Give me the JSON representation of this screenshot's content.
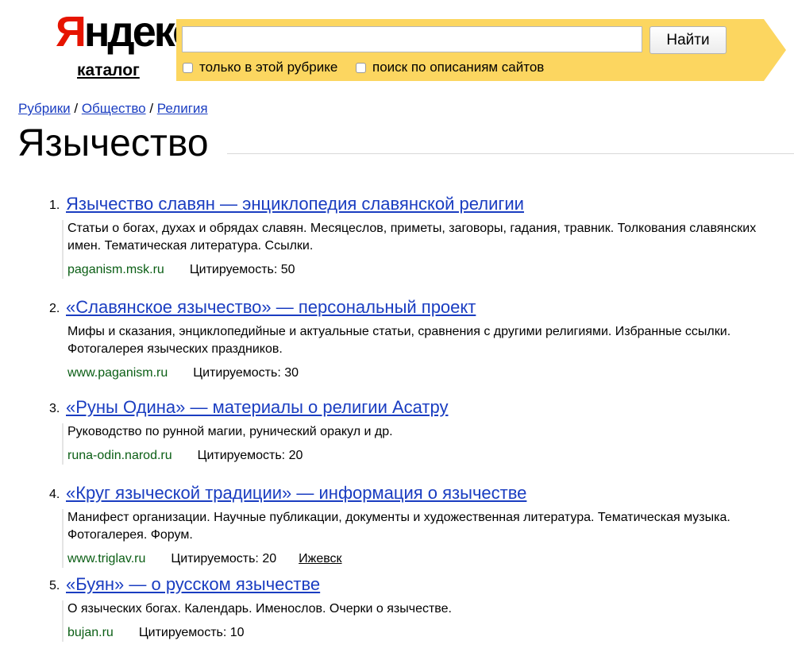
{
  "header": {
    "logo_red": "Я",
    "logo_black": "ндекс",
    "catalog_link": "каталог"
  },
  "search": {
    "query": "",
    "button_label": "Найти",
    "option_rubric": "только в этой рубрике",
    "option_descriptions": "поиск по описаниям сайтов"
  },
  "breadcrumb": {
    "items": [
      "Рубрики",
      "Общество",
      "Религия"
    ],
    "separator": " / "
  },
  "page": {
    "title": "Язычество"
  },
  "results": [
    {
      "number": "1.",
      "title": "Язычество славян — энциклопедия славянской религии",
      "description": "Статьи о богах, духах и обрядах славян. Месяцеслов, приметы, заговоры, гадания, травник. Толкования славянских имен. Тематическая литература. Ссылки.",
      "url": "paganism.msk.ru",
      "citation": "Цитируемость: 50"
    },
    {
      "number": "2.",
      "title": "«Славянское язычество» — персональный проект",
      "description": "Мифы и сказания, энциклопедийные и актуальные статьи, сравнения с другими религиями. Избранные ссылки. Фотогалерея языческих праздников.",
      "url": "www.paganism.ru",
      "citation": "Цитируемость: 30"
    },
    {
      "number": "3.",
      "title": "«Руны Одина» — материалы о религии Асатру",
      "description": "Руководство по рунной магии, рунический оракул и др.",
      "url": "runa-odin.narod.ru",
      "citation": "Цитируемость: 20"
    },
    {
      "number": "4.",
      "title": "«Круг языческой традиции» — информация о язычестве",
      "description": "Манифест организации. Научные публикации, документы и художественная литература. Тематическая музыка. Фотогалерея. Форум.",
      "url": "www.triglav.ru",
      "citation": "Цитируемость: 20",
      "region": "Ижевск"
    },
    {
      "number": "5.",
      "title": "«Буян» — о русском язычестве",
      "description": "О языческих богах. Календарь. Именослов. Очерки о язычестве.",
      "url": "bujan.ru",
      "citation": "Цитируемость: 10"
    }
  ],
  "colors": {
    "logo_red": "#e61400",
    "search_bar": "#fcd660",
    "link": "#1a3dc1",
    "url_green": "#0a5e14"
  }
}
